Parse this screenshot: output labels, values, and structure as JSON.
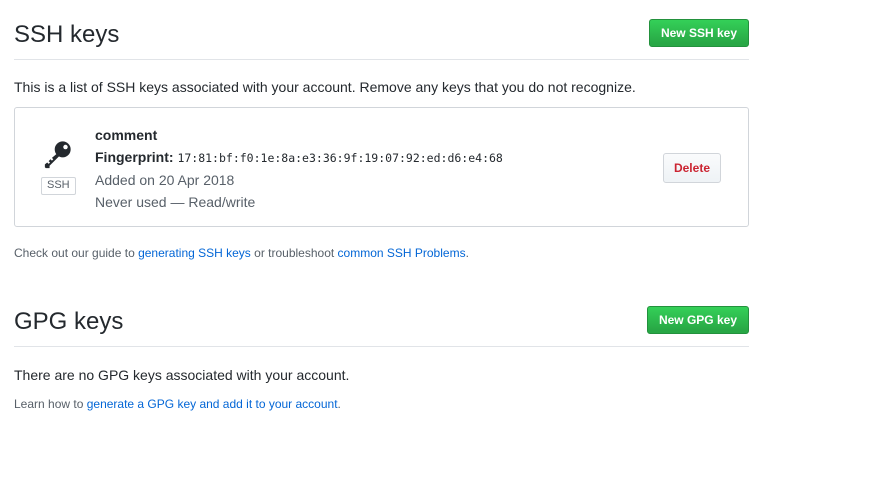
{
  "ssh": {
    "title": "SSH keys",
    "new_button": "New SSH key",
    "intro": "This is a list of SSH keys associated with your account. Remove any keys that you do not recognize.",
    "keys": [
      {
        "title": "comment",
        "badge": "SSH",
        "fingerprint_label": "Fingerprint:",
        "fingerprint": "17:81:bf:f0:1e:8a:e3:36:9f:19:07:92:ed:d6:e4:68",
        "added": "Added on 20 Apr 2018",
        "usage": "Never used — Read/write",
        "delete_label": "Delete",
        "icon": "key-icon"
      }
    ],
    "guide": {
      "prefix": "Check out our guide to ",
      "link1": "generating SSH keys",
      "middle": " or troubleshoot ",
      "link2": "common SSH Problems",
      "suffix": "."
    }
  },
  "gpg": {
    "title": "GPG keys",
    "new_button": "New GPG key",
    "empty": "There are no GPG keys associated with your account.",
    "learn": {
      "prefix": "Learn how to ",
      "link": "generate a GPG key and add it to your account",
      "suffix": "."
    }
  },
  "colors": {
    "primary_button": "#28a745",
    "link": "#0366d6",
    "danger": "#cb2431"
  }
}
